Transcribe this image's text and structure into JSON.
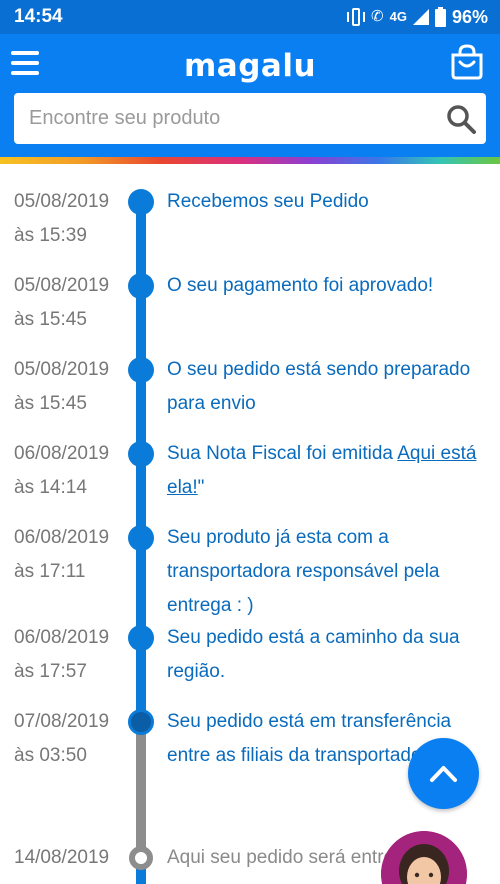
{
  "status_bar": {
    "time": "14:54",
    "network": "4G",
    "battery": "96%"
  },
  "header": {
    "logo": "magalu",
    "menu_icon": "hamburger-menu-icon",
    "bag_icon": "shopping-bag-icon",
    "search": {
      "placeholder": "Encontre seu produto",
      "value": "",
      "icon": "search-icon"
    }
  },
  "colors": {
    "brand_blue": "#0a7ff2",
    "timeline_blue": "#0a7bd8",
    "timeline_gray": "#8d8d8d",
    "event_text": "#0a6bbd"
  },
  "timeline": [
    {
      "date": "05/08/2019",
      "time": "às 15:39",
      "text": "Recebemos seu Pedido",
      "status": "done"
    },
    {
      "date": "05/08/2019",
      "time": "às 15:45",
      "text": "O seu pagamento foi aprovado!",
      "status": "done"
    },
    {
      "date": "05/08/2019",
      "time": "às 15:45",
      "text": "O seu pedido está sendo preparado para envio",
      "status": "done"
    },
    {
      "date": "06/08/2019",
      "time": "às 14:14",
      "text": "Sua Nota Fiscal foi emitida ",
      "link": "Aqui está ela!",
      "suffix": "\"",
      "status": "done"
    },
    {
      "date": "06/08/2019",
      "time": "às 17:11",
      "text": "Seu produto já esta com a transportadora responsável pela entrega : )",
      "status": "done"
    },
    {
      "date": "06/08/2019",
      "time": "às 17:57",
      "text": "Seu pedido está a caminho da sua região.",
      "status": "done"
    },
    {
      "date": "07/08/2019",
      "time": "às 03:50",
      "text": "Seu pedido está em transferência entre as filiais da transportadora",
      "status": "current"
    },
    {
      "date": "14/08/2019",
      "time": "",
      "text": "Aqui seu pedido será entregue",
      "status": "pending"
    }
  ],
  "floating": {
    "scroll_top_icon": "chevron-up-icon",
    "assistant_icon": "assistant-avatar"
  }
}
